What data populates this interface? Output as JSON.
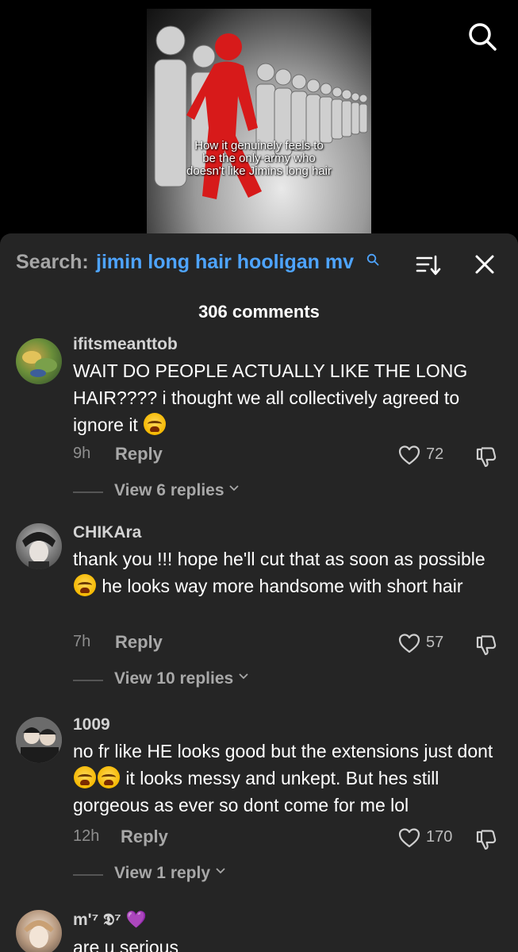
{
  "video": {
    "caption_lines": [
      "How it genuinely feels to",
      "be the only army who",
      "doesn't like Jimins long hair"
    ]
  },
  "top": {
    "search_icon": "search-icon"
  },
  "sheet": {
    "search_label": "Search:",
    "search_query": "jimin long hair hooligan mv",
    "comment_count": "306 comments",
    "icons": {
      "query": "search-small-icon",
      "sort": "sort-icon",
      "close": "close-icon"
    }
  },
  "comments": [
    {
      "username": "ifitsmeanttob",
      "text_parts": [
        "WAIT DO PEOPLE ACTUALLY LIKE THE LONG HAIR???? i thought we all collectively agreed to ignore it "
      ],
      "time": "9h",
      "reply_label": "Reply",
      "likes": "72",
      "view_replies": "View 6 replies"
    },
    {
      "username": "CHIKAra",
      "text_parts": [
        "thank you !!! hope he'll cut that as soon as possible ",
        " he looks way more handsome with short hair"
      ],
      "time": "7h",
      "reply_label": "Reply",
      "likes": "57",
      "view_replies": "View 10 replies"
    },
    {
      "username": "1009",
      "text_parts": [
        "no fr like HE looks good but the extensions just dont ",
        " it looks messy and unkept. But hes still gorgeous as ever so dont come for me lol"
      ],
      "time": "12h",
      "reply_label": "Reply",
      "likes": "170",
      "view_replies": "View 1 reply"
    },
    {
      "username": "m'⁷ 𝕯⁷ 💜",
      "text_parts": [
        "are u serious"
      ]
    }
  ],
  "colors": {
    "accent": "#4ea4ff",
    "sheet_bg": "#252525"
  }
}
